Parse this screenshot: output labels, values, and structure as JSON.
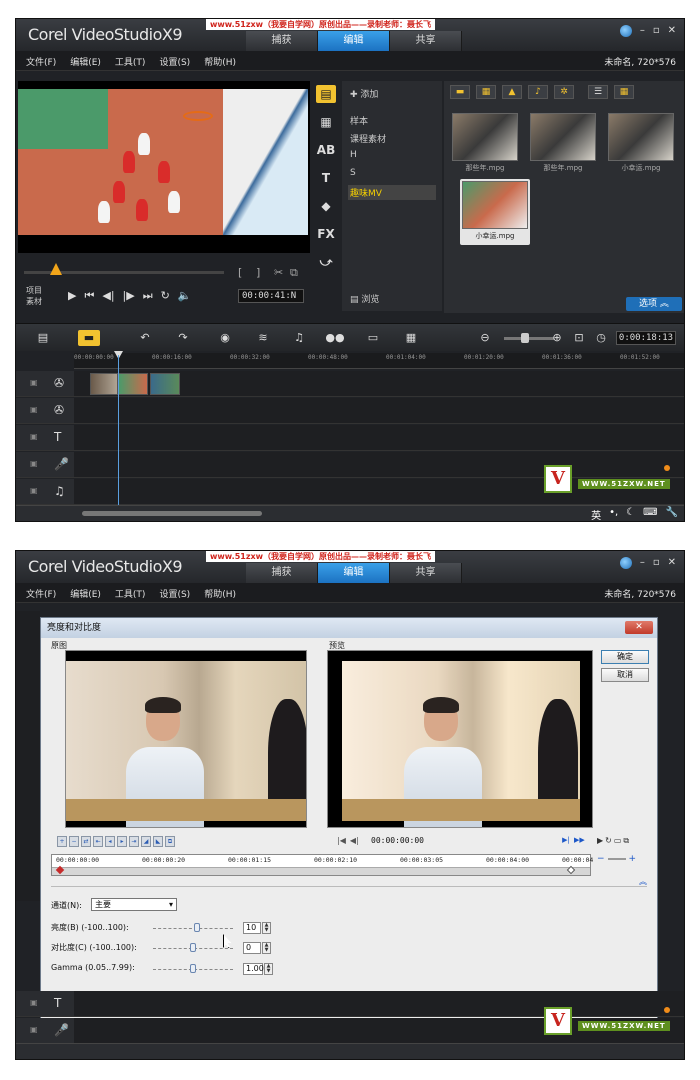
{
  "app": {
    "logo": "Corel VideoStudioX9",
    "banner": "www.51zxw（我要自学网）原创出品——录制老师：聂长飞",
    "tabs": [
      "捕获",
      "编辑",
      "共享"
    ],
    "active_tab": "编辑",
    "project_info": "未命名, 720*576",
    "menu": [
      "文件(F)",
      "编辑(E)",
      "工具(T)",
      "设置(S)",
      "帮助(H)"
    ]
  },
  "screen1": {
    "player": {
      "mode_labels": [
        "项目",
        "素材"
      ],
      "timecode": "00:00:41:N",
      "bracket_in": "[",
      "bracket_out": "]"
    },
    "library": {
      "add_label": "添加",
      "folders": [
        "样本",
        "课程素材",
        "H",
        "S",
        "趣味MV"
      ],
      "selected_folder": "趣味MV",
      "browse_label": "浏览",
      "thumbnails": [
        {
          "caption": "那些年.mpg"
        },
        {
          "caption": "那些年.mpg"
        },
        {
          "caption": "小幸运.mpg"
        },
        {
          "caption": "小幸运.mpg",
          "selected": true
        }
      ],
      "options_label": "选项"
    },
    "timeline": {
      "timecode": "0:00:18:13",
      "ruler_ticks": [
        "00:00:00:00",
        "00:00:16:00",
        "00:00:32:00",
        "00:00:48:00",
        "00:01:04:00",
        "00:01:20:00",
        "00:01:36:00",
        "00:01:52:00"
      ]
    },
    "watermark": "WWW.51ZXW.NET",
    "ime": "英"
  },
  "screen2": {
    "dialog": {
      "title": "亮度和对比度",
      "original_label": "原图",
      "preview_label": "预览",
      "ok_label": "确定",
      "cancel_label": "取消",
      "timecode": "00:00:00:00",
      "ruler_ticks": [
        "00:00:00:00",
        "00:00:00:20",
        "00:00:01:15",
        "00:00:02:10",
        "00:00:03:05",
        "00:00:04:00",
        "00:00:04"
      ],
      "channel_label": "通道(N):",
      "channel_value": "主要",
      "brightness": {
        "label": "亮度(B) (-100..100):",
        "value": "10",
        "fraction": 0.55
      },
      "contrast": {
        "label": "对比度(C) (-100..100):",
        "value": "0",
        "fraction": 0.5
      },
      "gamma": {
        "label": "Gamma (0.05..7.99):",
        "value": "1.00",
        "fraction": 0.5
      }
    },
    "watermark": "WWW.51ZXW.NET"
  },
  "colors": {
    "accent_blue": "#1c72c2",
    "accent_yellow": "#f2c230",
    "bg_dark": "#202226"
  }
}
